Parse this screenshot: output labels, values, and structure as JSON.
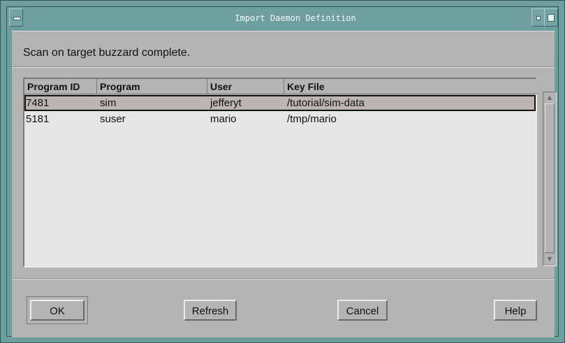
{
  "window": {
    "title": "Import Daemon Definition"
  },
  "status_text": "Scan on target buzzard complete.",
  "table": {
    "columns": [
      "Program ID",
      "Program",
      "User",
      "Key File"
    ],
    "rows": [
      [
        "7481",
        "sim",
        "jefferyt",
        "/tutorial/sim-data"
      ],
      [
        "5181",
        "suser",
        "mario",
        "/tmp/mario"
      ]
    ]
  },
  "buttons": {
    "ok": "OK",
    "refresh": "Refresh",
    "cancel": "Cancel",
    "help": "Help"
  },
  "icons": {
    "window_menu": "window-menu-icon",
    "minimize": "minimize-icon",
    "maximize": "maximize-icon",
    "scroll_up": "scroll-up-arrow-icon",
    "scroll_down": "scroll-down-arrow-icon"
  }
}
